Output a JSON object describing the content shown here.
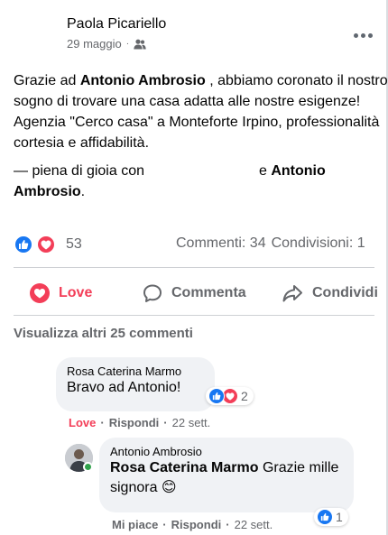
{
  "post": {
    "author": "Paola Picariello",
    "date": "29 maggio",
    "audience_icon": "friends-icon",
    "body_prefix": "Grazie ad ",
    "body_mention": "Antonio Ambrosio",
    "body_rest": " , abbiamo coronato il nostro sogno di trovare una casa adatta alle nostre esigenze! Agenzia \"Cerco casa\" a Monteforte Irpino, professionalità cortesia e affidabilità.",
    "feeling_prefix": "— piena di gioia con",
    "feeling_and": "e",
    "feeling_mention": "Antonio Ambrosio",
    "feeling_end": "."
  },
  "reactions": {
    "icons": [
      "like-icon",
      "love-icon"
    ],
    "count": "53",
    "comments_label": "Commenti: 34",
    "shares_label": "Condivisioni: 1"
  },
  "actions": {
    "love": "Love",
    "comment": "Commenta",
    "share": "Condividi"
  },
  "more_comments": "Visualizza altri 25 commenti",
  "comments": [
    {
      "author": "Rosa Caterina Marmo",
      "text": "Bravo ad Antonio!",
      "reaction_count": "2",
      "reaction_label": "Love",
      "reply_label": "Rispondi",
      "time": "22 sett."
    },
    {
      "author": "Antonio Ambrosio",
      "mention": "Rosa Caterina Marmo",
      "text": " Grazie mille signora 😊",
      "reaction_count": "1",
      "reaction_label": "Mi piace",
      "reply_label": "Rispondi",
      "time": "22 sett."
    }
  ],
  "colors": {
    "like_blue": "#1877f2",
    "love_red": "#f33e58",
    "secondary_text": "#65676b",
    "bubble_bg": "#f0f2f5",
    "online_green": "#31a24c"
  }
}
